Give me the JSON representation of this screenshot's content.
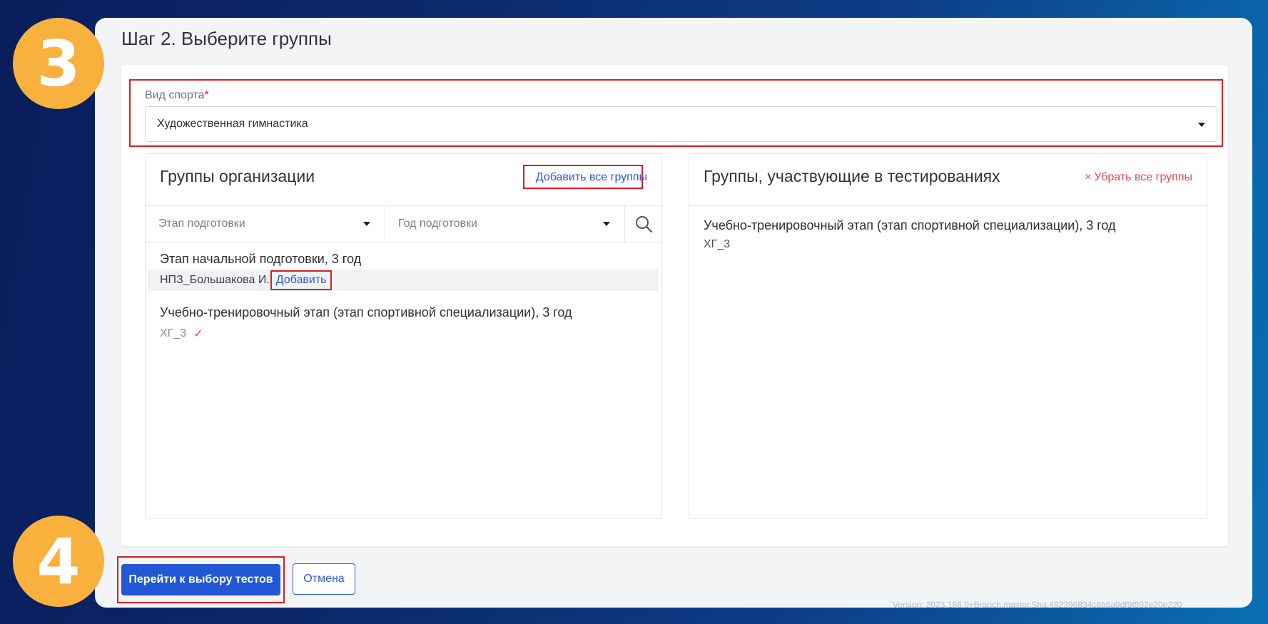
{
  "badges": {
    "step3": "3",
    "step4": "4"
  },
  "page": {
    "title": "Шаг 2. Выберите группы"
  },
  "sport": {
    "label": "Вид спорта",
    "required_mark": "*",
    "value": "Художественная гимнастика"
  },
  "org_groups": {
    "title": "Группы организации",
    "add_all_label": "Добавить все группы",
    "filters": {
      "stage_placeholder": "Этап подготовки",
      "year_placeholder": "Год подготовки"
    },
    "groups": [
      {
        "title": "Этап начальной подготовки, 3 год",
        "code": "НПЗ_Большакова И.",
        "action": "Добавить"
      },
      {
        "title": "Учебно-тренировочный этап (этап спортивной специализации), 3 год",
        "code": "ХГ_3",
        "status": "✓"
      }
    ]
  },
  "testing_groups": {
    "title": "Группы, участвующие в тестированиях",
    "remove_all_label": "Убрать все группы",
    "remove_all_icon": "×",
    "groups": [
      {
        "title": "Учебно-тренировочный этап (этап спортивной специализации), 3 год",
        "code": "ХГ_3"
      }
    ]
  },
  "footer": {
    "next_label": "Перейти к выбору тестов",
    "cancel_label": "Отмена",
    "version": "Version: 2023.186.0+Branch.master.Sha.492396834c8b6a9df9f892e20e220"
  },
  "colors": {
    "highlight": "#e01b24",
    "primary": "#2257d6",
    "badge": "#f7b13c"
  }
}
